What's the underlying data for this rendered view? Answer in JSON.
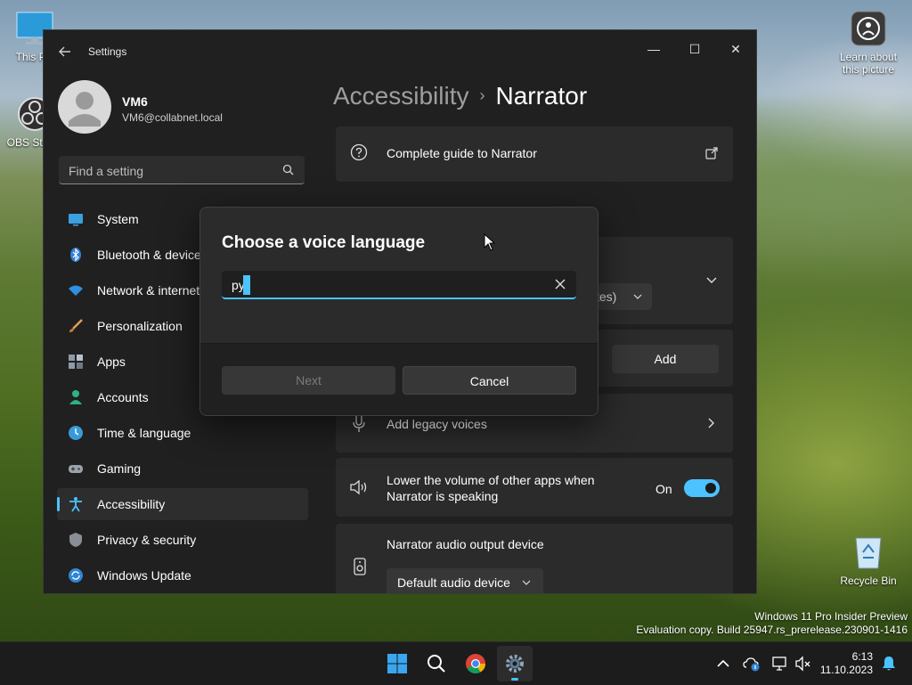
{
  "desktop": {
    "icons": [
      {
        "label": "This PC"
      },
      {
        "label": "OBS Studio"
      },
      {
        "label": "Learn about this picture"
      },
      {
        "label": "Recycle Bin"
      }
    ]
  },
  "window": {
    "title": "Settings",
    "controls": {
      "minimize": "—",
      "maximize": "☐",
      "close": "✕"
    }
  },
  "profile": {
    "name": "VM6",
    "email": "VM6@collabnet.local"
  },
  "search": {
    "placeholder": "Find a setting",
    "value": ""
  },
  "nav": {
    "items": [
      {
        "label": "System"
      },
      {
        "label": "Bluetooth & devices"
      },
      {
        "label": "Network & internet"
      },
      {
        "label": "Personalization"
      },
      {
        "label": "Apps"
      },
      {
        "label": "Accounts"
      },
      {
        "label": "Time & language"
      },
      {
        "label": "Gaming"
      },
      {
        "label": "Accessibility",
        "active": true
      },
      {
        "label": "Privacy & security"
      },
      {
        "label": "Windows Update"
      }
    ]
  },
  "breadcrumb": {
    "parent": "Accessibility",
    "separator": "›",
    "current": "Narrator"
  },
  "content": {
    "guide": "Complete guide to Narrator",
    "voice_dropdown_fragment": "tes)",
    "add_button": "Add",
    "legacy_voices": "Add legacy voices",
    "lower_volume": {
      "label_line1": "Lower the volume of other apps when",
      "label_line2": "Narrator is speaking",
      "state": "On"
    },
    "audio_output": {
      "label": "Narrator audio output device",
      "selected": "Default audio device"
    }
  },
  "dialog": {
    "title": "Choose a voice language",
    "input_value": "py",
    "next_label": "Next",
    "cancel_label": "Cancel"
  },
  "watermark": {
    "line1": "Windows 11 Pro Insider Preview",
    "line2": "Evaluation copy. Build 25947.rs_prerelease.230901-1416"
  },
  "taskbar": {
    "time": "6:13",
    "date": "11.10.2023"
  },
  "colors": {
    "accent": "#4cc2ff",
    "window_bg": "#202020",
    "card_bg": "#2b2b2b"
  }
}
